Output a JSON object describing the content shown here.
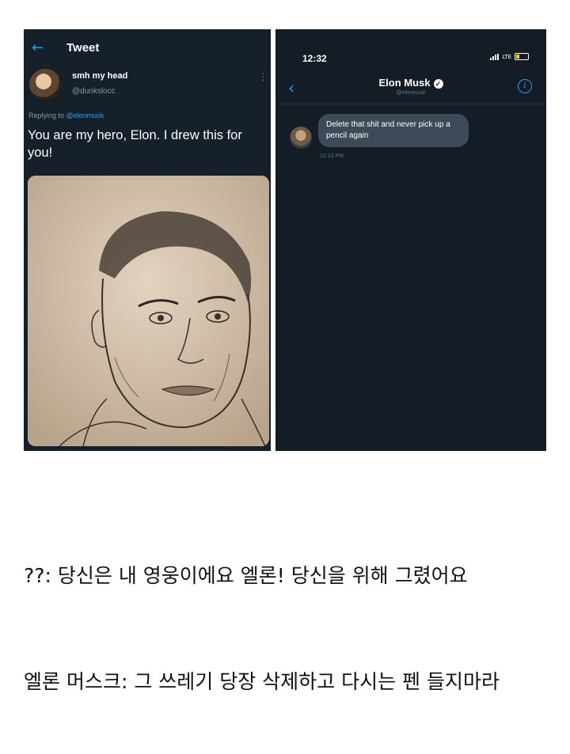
{
  "tweet": {
    "header_title": "Tweet",
    "back_icon": "arrow-left-icon",
    "user_name": "smh my head",
    "user_handle": "@dunkslocc",
    "replying_prefix": "Replying to",
    "replying_mention": "@elonmusk",
    "text": "You are my hero, Elon. I drew this for you!",
    "image": "pencil-sketch-portrait"
  },
  "dm": {
    "time": "12:32",
    "network": "LTE",
    "contact_name": "Elon Musk",
    "contact_handle": "@elonmusk",
    "message": "Delete that shit and never pick up a pencil again",
    "message_time": "12:13 PM"
  },
  "captions": {
    "line1": "??: 당신은 내 영웅이에요 엘론! 당신을 위해 그렸어요",
    "line2": "엘론 머스크: 그 쓰레기 당장 삭제하고 다시는 펜 들지마라"
  },
  "colors": {
    "tweet_bg": "#15202b",
    "dm_bg": "#141d26",
    "accent": "#1da1f2",
    "bubble": "#3d4a57"
  }
}
